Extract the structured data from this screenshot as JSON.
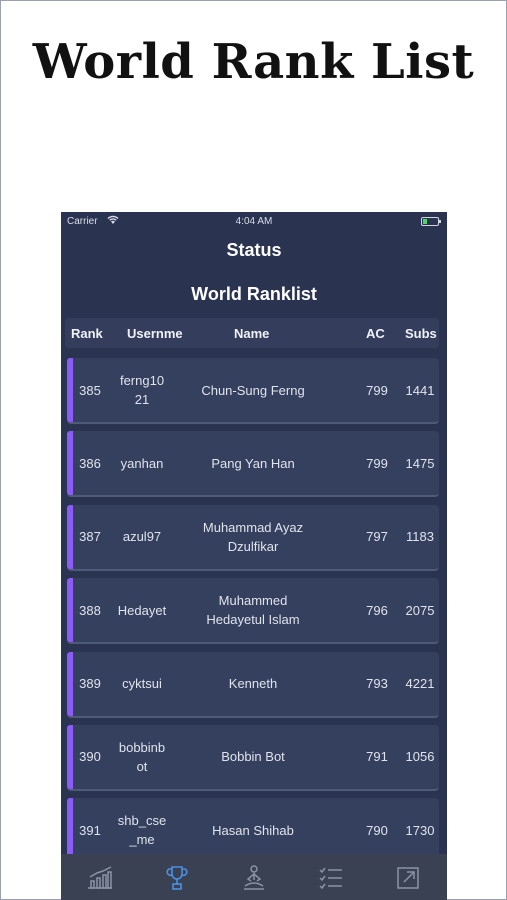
{
  "page": {
    "title": "World Rank List"
  },
  "status_bar": {
    "carrier": "Carrier",
    "time": "4:04 AM"
  },
  "nav": {
    "title": "Status"
  },
  "section": {
    "title": "World Ranklist"
  },
  "table": {
    "columns": [
      "Rank",
      "Usernme",
      "Name",
      "AC",
      "Subs"
    ],
    "rows": [
      {
        "rank": "385",
        "username": "ferng1021",
        "name": "Chun-Sung Ferng",
        "ac": "799",
        "subs": "1441"
      },
      {
        "rank": "386",
        "username": "yanhan",
        "name": "Pang Yan Han",
        "ac": "799",
        "subs": "1475"
      },
      {
        "rank": "387",
        "username": "azul97",
        "name": "Muhammad Ayaz Dzulfikar",
        "ac": "797",
        "subs": "1183"
      },
      {
        "rank": "388",
        "username": "Hedayet",
        "name": "Muhammed Hedayetul Islam",
        "ac": "796",
        "subs": "2075"
      },
      {
        "rank": "389",
        "username": "cyktsui",
        "name": "Kenneth",
        "ac": "793",
        "subs": "4221"
      },
      {
        "rank": "390",
        "username": "bobbinbot",
        "name": "Bobbin Bot",
        "ac": "791",
        "subs": "1056"
      },
      {
        "rank": "391",
        "username": "shb_cse_me",
        "name": "Hasan Shihab",
        "ac": "790",
        "subs": "1730"
      }
    ]
  },
  "tab_bar": {
    "tabs": [
      {
        "icon": "chart-icon",
        "active": false
      },
      {
        "icon": "trophy-icon",
        "active": true
      },
      {
        "icon": "meditation-icon",
        "active": false
      },
      {
        "icon": "checklist-icon",
        "active": false
      },
      {
        "icon": "external-link-icon",
        "active": false
      }
    ]
  },
  "colors": {
    "background": "#2a3350",
    "row": "#35405e",
    "accent": "#8b5cf6",
    "tab_active": "#4a90e2",
    "tab_inactive": "#8c93a6"
  }
}
